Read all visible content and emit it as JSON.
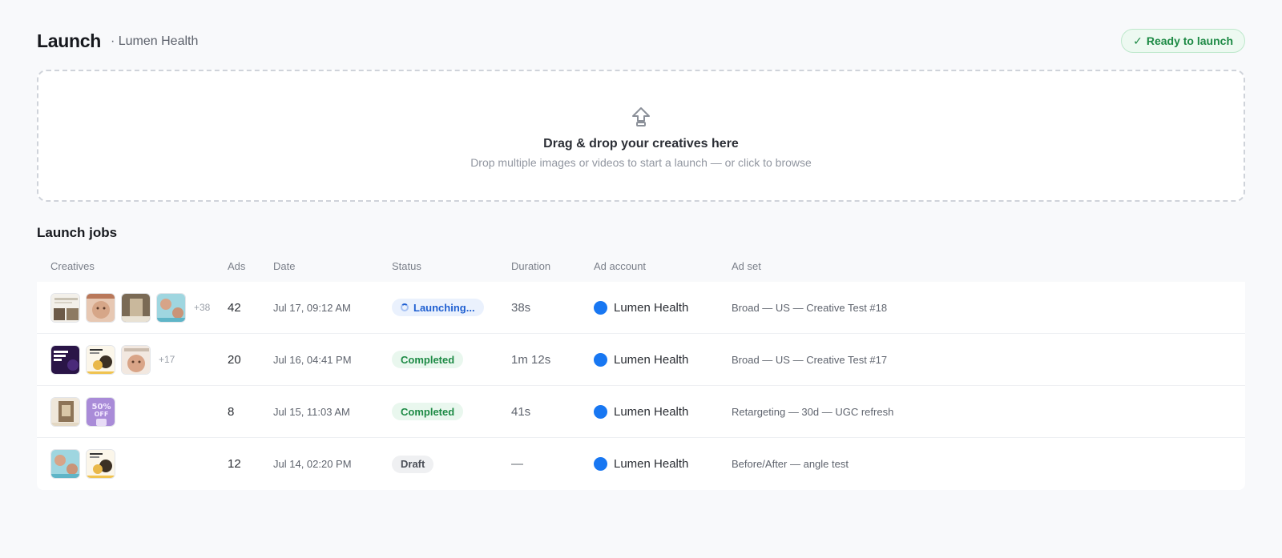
{
  "header": {
    "title": "Launch",
    "subtitle": "· Lumen Health",
    "status_badge": {
      "icon": "check-icon",
      "label": "Ready to launch"
    }
  },
  "dropzone": {
    "icon": "upload-arrow-icon",
    "title": "Drag & drop your creatives here",
    "subtitle": "Drop multiple images or videos to start a launch — or click to browse"
  },
  "jobs": {
    "section_title": "Launch jobs",
    "columns": [
      "Creatives",
      "Ads",
      "Date",
      "Status",
      "Duration",
      "Ad account",
      "Ad set"
    ],
    "rows": [
      {
        "more": "+38",
        "ads": "42",
        "date": "Jul 17, 09:12 AM",
        "status": "Launching...",
        "status_type": "launching",
        "duration": "38s",
        "account": "Lumen Health",
        "adset": "Broad — US — Creative Test #18"
      },
      {
        "more": "+17",
        "ads": "20",
        "date": "Jul 16, 04:41 PM",
        "status": "Completed",
        "status_type": "completed",
        "duration": "1m 12s",
        "account": "Lumen Health",
        "adset": "Broad — US — Creative Test #17"
      },
      {
        "more": "",
        "ads": "8",
        "date": "Jul 15, 11:03 AM",
        "status": "Completed",
        "status_type": "completed",
        "duration": "41s",
        "account": "Lumen Health",
        "adset": "Retargeting — 30d — UGC refresh"
      },
      {
        "more": "",
        "ads": "12",
        "date": "Jul 14, 02:20 PM",
        "status": "Draft",
        "status_type": "draft",
        "duration": "—",
        "account": "Lumen Health",
        "adset": "Before/After — angle test"
      }
    ]
  },
  "colors": {
    "accent": "#1877f2",
    "success": "#1d8a45",
    "launching": "#1f5fd1"
  }
}
